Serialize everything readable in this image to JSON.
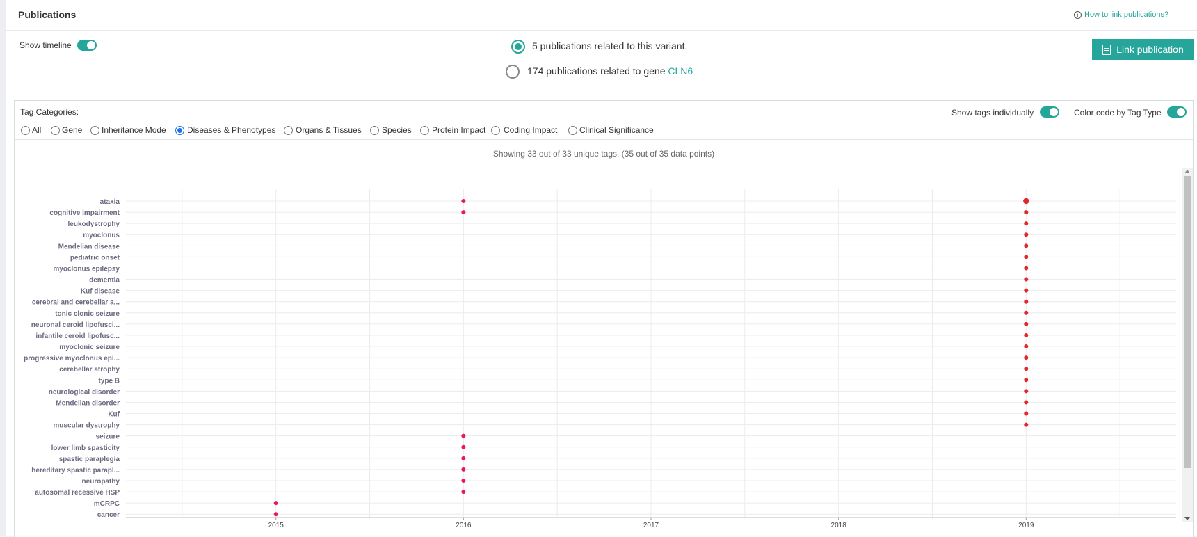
{
  "header": {
    "title": "Publications",
    "help_link": "How to link publications?"
  },
  "controls": {
    "show_timeline_label": "Show timeline",
    "variant_option": "5 publications related to this variant.",
    "gene_option_prefix": "174 publications related to gene ",
    "gene_name": "CLN6",
    "link_button": "Link publication"
  },
  "tags": {
    "categories_label": "Tag Categories:",
    "show_individually_label": "Show tags individually",
    "color_code_label": "Color code by Tag Type",
    "categories": [
      "All",
      "Gene",
      "Inheritance Mode",
      "Diseases & Phenotypes",
      "Organs & Tissues",
      "Species",
      "Protein Impact",
      "Coding Impact",
      "Clinical Significance"
    ],
    "selected": "Diseases & Phenotypes",
    "showing_text": "Showing 33 out of 33 unique tags. (35 out of 35 data points)"
  },
  "chart_data": {
    "type": "scatter",
    "x_ticks": [
      "2015",
      "2016",
      "2017",
      "2018",
      "2019"
    ],
    "xlim": [
      2014.2,
      2019.8
    ],
    "colors": {
      "point": "#e0282e",
      "point_alt": "#e8195c"
    },
    "categories": [
      "ataxia",
      "cognitive impairment",
      "leukodystrophy",
      "myoclonus",
      "Mendelian disease",
      "pediatric onset",
      "myoclonus epilepsy",
      "dementia",
      "Kuf disease",
      "cerebral and cerebellar a...",
      "tonic clonic seizure",
      "neuronal ceroid lipofusci...",
      "infantile ceroid lipofusc...",
      "myoclonic seizure",
      "progressive myoclonus epi...",
      "cerebellar atrophy",
      "type B",
      "neurological disorder",
      "Mendelian disorder",
      "Kuf",
      "muscular dystrophy",
      "seizure",
      "lower limb spasticity",
      "spastic paraplegia",
      "hereditary spastic parapl...",
      "neuropathy",
      "autosomal recessive HSP",
      "mCRPC",
      "cancer"
    ],
    "points": [
      {
        "tag": "ataxia",
        "year": 2016,
        "count": 1
      },
      {
        "tag": "ataxia",
        "year": 2019,
        "count": 2
      },
      {
        "tag": "cognitive impairment",
        "year": 2016,
        "count": 1
      },
      {
        "tag": "cognitive impairment",
        "year": 2019,
        "count": 1
      },
      {
        "tag": "leukodystrophy",
        "year": 2019,
        "count": 1
      },
      {
        "tag": "myoclonus",
        "year": 2019,
        "count": 1
      },
      {
        "tag": "Mendelian disease",
        "year": 2019,
        "count": 1
      },
      {
        "tag": "pediatric onset",
        "year": 2019,
        "count": 1
      },
      {
        "tag": "myoclonus epilepsy",
        "year": 2019,
        "count": 1
      },
      {
        "tag": "dementia",
        "year": 2019,
        "count": 1
      },
      {
        "tag": "Kuf disease",
        "year": 2019,
        "count": 1
      },
      {
        "tag": "cerebral and cerebellar a...",
        "year": 2019,
        "count": 1
      },
      {
        "tag": "tonic clonic seizure",
        "year": 2019,
        "count": 1
      },
      {
        "tag": "neuronal ceroid lipofusci...",
        "year": 2019,
        "count": 1
      },
      {
        "tag": "infantile ceroid lipofusc...",
        "year": 2019,
        "count": 1
      },
      {
        "tag": "myoclonic seizure",
        "year": 2019,
        "count": 1
      },
      {
        "tag": "progressive myoclonus epi...",
        "year": 2019,
        "count": 1
      },
      {
        "tag": "cerebellar atrophy",
        "year": 2019,
        "count": 1
      },
      {
        "tag": "type B",
        "year": 2019,
        "count": 1
      },
      {
        "tag": "neurological disorder",
        "year": 2019,
        "count": 1
      },
      {
        "tag": "Mendelian disorder",
        "year": 2019,
        "count": 1
      },
      {
        "tag": "Kuf",
        "year": 2019,
        "count": 1
      },
      {
        "tag": "muscular dystrophy",
        "year": 2019,
        "count": 1
      },
      {
        "tag": "seizure",
        "year": 2016,
        "count": 1
      },
      {
        "tag": "lower limb spasticity",
        "year": 2016,
        "count": 1
      },
      {
        "tag": "spastic paraplegia",
        "year": 2016,
        "count": 1
      },
      {
        "tag": "hereditary spastic parapl...",
        "year": 2016,
        "count": 1
      },
      {
        "tag": "neuropathy",
        "year": 2016,
        "count": 1
      },
      {
        "tag": "autosomal recessive HSP",
        "year": 2016,
        "count": 1
      },
      {
        "tag": "mCRPC",
        "year": 2015,
        "count": 1
      },
      {
        "tag": "cancer",
        "year": 2015,
        "count": 1
      }
    ]
  }
}
